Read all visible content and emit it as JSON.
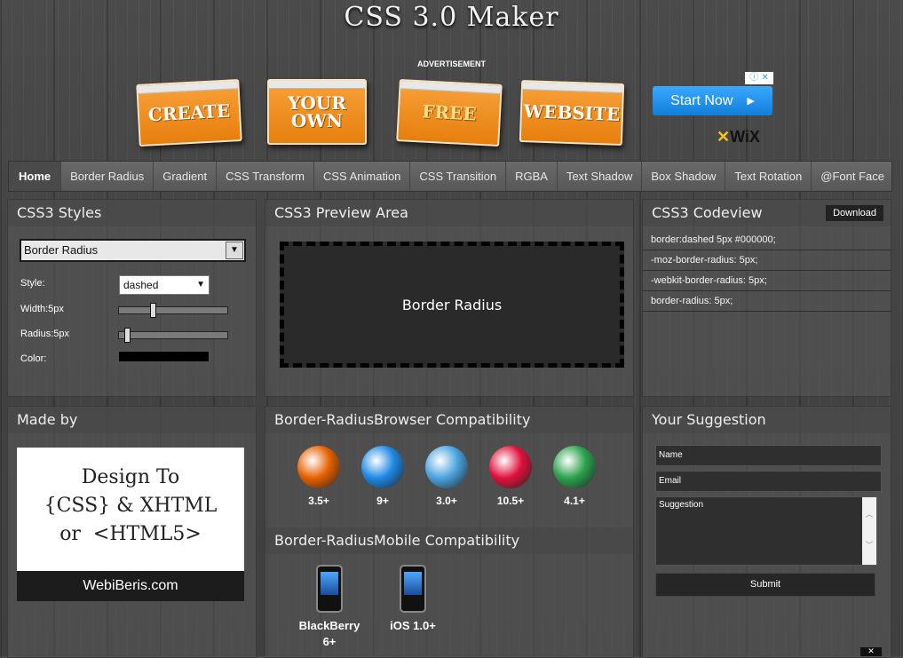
{
  "app": {
    "title": "CSS 3.0 Maker"
  },
  "ad": {
    "label": "ADVERTISEMENT",
    "cards": [
      "CREATE",
      "YOUR OWN",
      "FREE",
      "WEBSITE"
    ],
    "cta": "Start Now",
    "brand": "WiX"
  },
  "nav": {
    "items": [
      "Home",
      "Border Radius",
      "Gradient",
      "CSS Transform",
      "CSS Animation",
      "CSS Transition",
      "RGBA",
      "Text Shadow",
      "Box Shadow",
      "Text Rotation",
      "@Font Face"
    ],
    "active": "Home"
  },
  "styles": {
    "heading": "CSS3 Styles",
    "property_select": "Border Radius",
    "style_label": "Style:",
    "style_value": "dashed",
    "width_label": "Width:5px",
    "width_level": 0.3,
    "radius_label": "Radius:5px",
    "radius_level": 0.05,
    "color_label": "Color:",
    "color_value": "#000000"
  },
  "preview": {
    "heading": "CSS3 Preview Area",
    "box_text": "Border Radius"
  },
  "codeview": {
    "heading": "CSS3 Codeview",
    "download_label": "Download",
    "lines": [
      "border:dashed 5px #000000;",
      "-moz-border-radius: 5px;",
      "-webkit-border-radius: 5px;",
      "border-radius: 5px;"
    ]
  },
  "madeby": {
    "heading": "Made by",
    "line1": "Design To",
    "line2": "{CSS} & XHTML",
    "line3": "or  <HTML5>",
    "site": "WebiBeris.com"
  },
  "compat": {
    "browser_heading": "Border-RadiusBrowser Compatibility",
    "browsers": [
      {
        "icon": "firefox-icon",
        "version": "3.5+",
        "color": "#e66000"
      },
      {
        "icon": "ie-icon",
        "version": "9+",
        "color": "#1e88e5"
      },
      {
        "icon": "safari-icon",
        "version": "3.0+",
        "color": "#4aa3df"
      },
      {
        "icon": "opera-icon",
        "version": "10.5+",
        "color": "#e0103b"
      },
      {
        "icon": "chrome-icon",
        "version": "4.1+",
        "color": "#2ba24c"
      }
    ],
    "mobile_heading": "Border-RadiusMobile Compatibility",
    "mobile": [
      {
        "icon": "blackberry-icon",
        "line1": "BlackBerry",
        "line2": "6+"
      },
      {
        "icon": "iphone-icon",
        "line1": "iOS 1.0+",
        "line2": ""
      }
    ]
  },
  "suggestion": {
    "heading": "Your Suggestion",
    "name_placeholder": "Name",
    "email_placeholder": "Email",
    "suggestion_placeholder": "Suggestion",
    "submit_label": "Submit"
  }
}
